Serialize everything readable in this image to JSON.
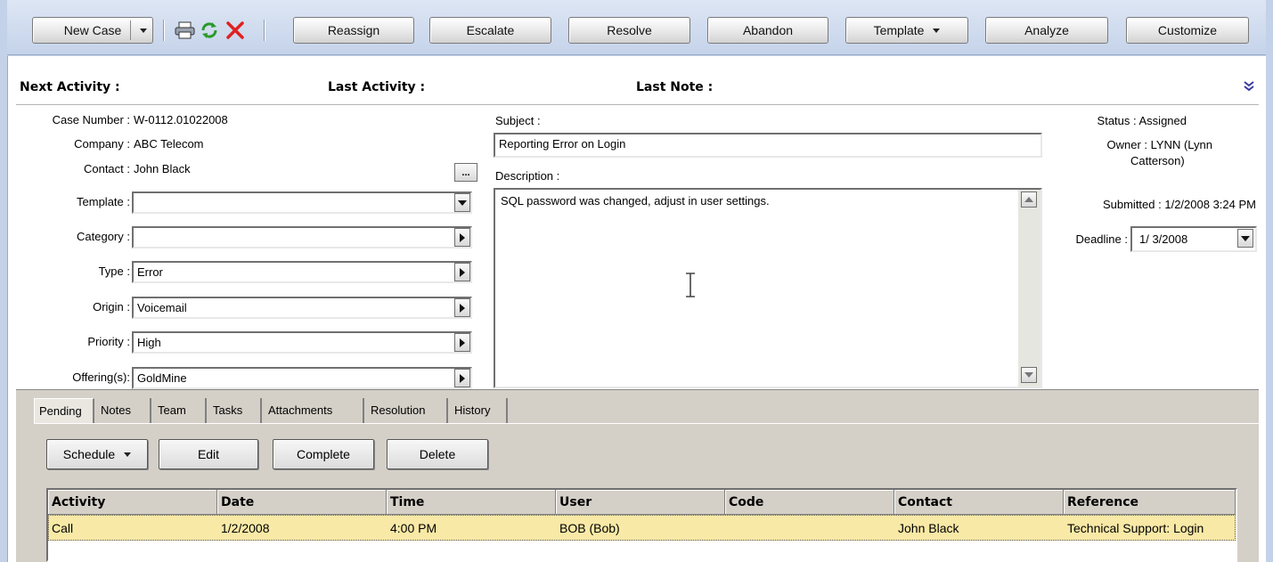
{
  "toolbar": {
    "new_case": "New Case",
    "reassign": "Reassign",
    "escalate": "Escalate",
    "resolve": "Resolve",
    "abandon": "Abandon",
    "template": "Template",
    "analyze": "Analyze",
    "customize": "Customize",
    "icons": [
      "printer-icon",
      "refresh-icon",
      "delete-icon"
    ]
  },
  "activity_bar": {
    "next_activity": "Next Activity :",
    "last_activity": "Last Activity :",
    "last_note": "Last Note :"
  },
  "case": {
    "case_number_label": "Case Number :",
    "case_number": "W-0112.01022008",
    "company_label": "Company :",
    "company": "ABC Telecom",
    "contact_label": "Contact :",
    "contact": "John Black",
    "browse_label": "...",
    "template_label": "Template :",
    "template": "",
    "category_label": "Category :",
    "category": "",
    "type_label": "Type :",
    "type": "Error",
    "origin_label": "Origin :",
    "origin": "Voicemail",
    "priority_label": "Priority :",
    "priority": "High",
    "offering_label": "Offering(s):",
    "offering": "GoldMine",
    "subject_label": "Subject :",
    "subject": "Reporting Error on Login",
    "description_label": "Description :",
    "description": "SQL password was changed, adjust in user settings.",
    "status_label": "Status :",
    "status": "Assigned",
    "owner_label": "Owner :",
    "owner_line1": "LYNN (Lynn",
    "owner_line2": "Catterson)",
    "submitted_label": "Submitted :",
    "submitted": "1/2/2008 3:24 PM",
    "deadline_label": "Deadline :",
    "deadline": "1/  3/2008"
  },
  "tabs": [
    "Pending",
    "Notes",
    "Team",
    "Tasks",
    "Attachments",
    "Resolution",
    "History"
  ],
  "pending": {
    "schedule": "Schedule",
    "edit": "Edit",
    "complete": "Complete",
    "delete": "Delete",
    "columns": [
      "Activity",
      "Date",
      "Time",
      "User",
      "Code",
      "Contact",
      "Reference"
    ],
    "rows": [
      [
        "Call",
        "1/2/2008",
        "4:00 PM",
        "BOB (Bob)",
        "",
        "John Black",
        "Technical Support: Login"
      ]
    ]
  },
  "colors": {
    "toolbar_bg": "#c5d3ea",
    "selected_row": "#f9e9a6",
    "delete_red": "#e02020",
    "refresh_green": "#2a9a2a"
  }
}
